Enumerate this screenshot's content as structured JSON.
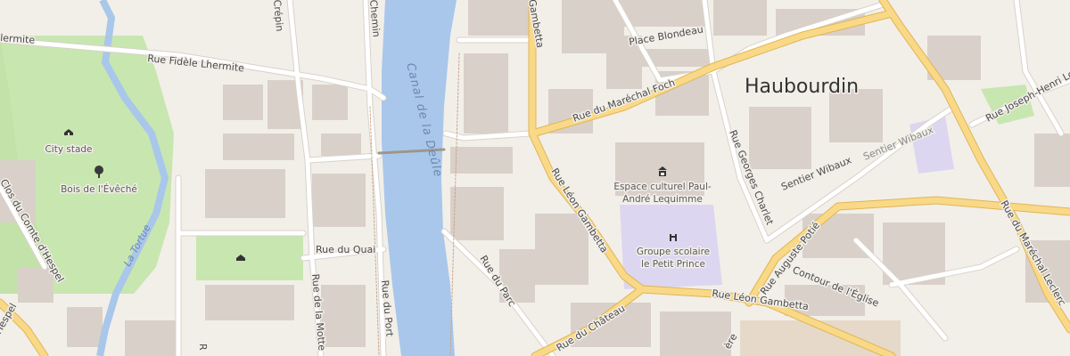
{
  "map": {
    "colors": {
      "background": "#f2efe9",
      "building": "#d9d0c9",
      "water": "#a9c7ea",
      "park": "#c8e6b0",
      "school": "#ddd6f0",
      "main_road": "#f9d987",
      "main_road_casing": "#e0b553",
      "minor_road": "#ffffff",
      "minor_road_casing": "#d8d2ca"
    },
    "labels": {
      "city": "Haubourdin",
      "canal": "Canal de la Deûle",
      "tortue": "La Tortue",
      "fidele": "Rue Fidèle Lhermite",
      "fidele_partial": "lermite",
      "crepin": "Crépin",
      "chemin": "Chemin",
      "gambetta_top": "Gambetta",
      "place": "Place Blondeau",
      "foch": "Rue du Maréchal Foch",
      "joseph": "Rue Joseph-Henri Louwyck",
      "wibaux": "Sentier Wibaux",
      "wibaux2": "Sentier Wibaux",
      "georges": "Rue Georges Charlet",
      "leon_diag": "Rue Léon Gambetta",
      "leon_bottom": "Rue Léon Gambetta",
      "quai": "Rue du Quai",
      "motte": "Rue de la Motte",
      "port": "Rue du Port",
      "parc": "Rue du Parc",
      "chateau": "Rue du Château",
      "potie": "Rue Auguste Potié",
      "contour": "Contour de l'Église",
      "marechal_leclerc": "Rue du Maréchal Leclerc",
      "clos": "Clos du Comte d'Hespel",
      "hespel": "Hespel",
      "bottom_r": "R",
      "bottom_stub": "ère",
      "city_stade": "City stade",
      "bois": "Bois de l'Évêché",
      "espace_1": "Espace culturel Paul-",
      "espace_2": "André Lequimme",
      "groupe_1": "Groupe scolaire",
      "groupe_2": "le Petit Prince"
    },
    "icons": {
      "stadium": "stadium-icon",
      "tree": "tree-icon",
      "museum": "museum-icon",
      "school": "school-icon"
    }
  }
}
